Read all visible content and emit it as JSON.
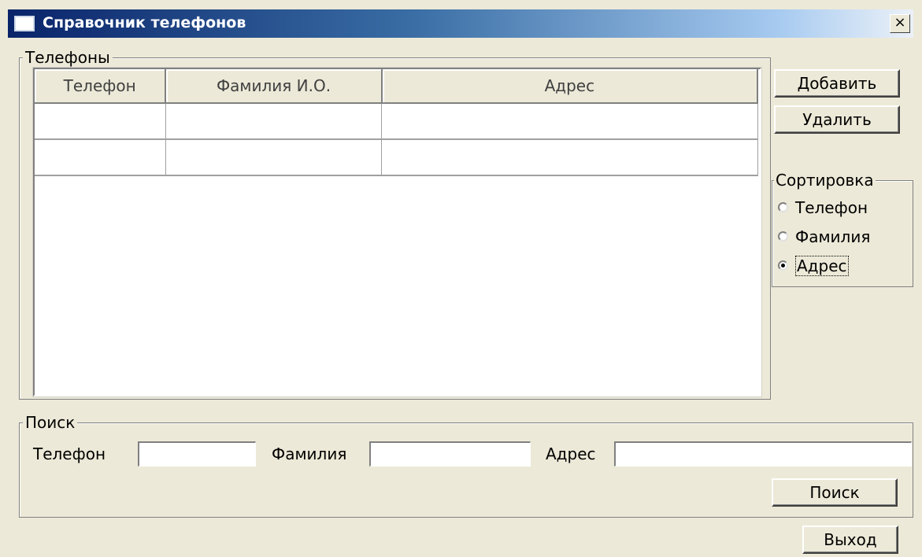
{
  "window": {
    "title": "Справочник телефонов",
    "close_label": "×"
  },
  "phones_group": {
    "legend": "Телефоны",
    "columns": [
      "Телефон",
      "Фамилия И.О.",
      "Адрес"
    ],
    "rows": [
      [
        "",
        "",
        ""
      ],
      [
        "",
        "",
        ""
      ]
    ]
  },
  "actions": {
    "add_label": "Добавить",
    "delete_label": "Удалить"
  },
  "sort_group": {
    "legend": "Сортировка",
    "options": [
      {
        "label": "Телефон",
        "checked": false
      },
      {
        "label": "Фамилия",
        "checked": false
      },
      {
        "label": "Адрес",
        "checked": true
      }
    ]
  },
  "search_group": {
    "legend": "Поиск",
    "phone_label": "Телефон",
    "phone_value": "",
    "surname_label": "Фамилия",
    "surname_value": "",
    "address_label": "Адрес",
    "address_value": "",
    "search_button": "Поиск"
  },
  "exit_button": "Выход"
}
